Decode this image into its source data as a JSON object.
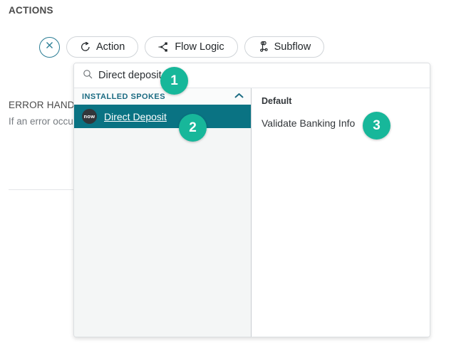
{
  "page": {
    "actions_heading": "ACTIONS"
  },
  "error_handling": {
    "title": "ERROR HANDLING",
    "description": "If an error occurs"
  },
  "add_step_row": {
    "close_button": {
      "icon": "close-x-icon",
      "label": ""
    },
    "buttons": [
      {
        "label": "Action",
        "icon": "action-arrow-icon"
      },
      {
        "label": "Flow Logic",
        "icon": "flow-logic-icon"
      },
      {
        "label": "Subflow",
        "icon": "subflow-icon"
      }
    ]
  },
  "spoke_panel": {
    "search": {
      "value": "Direct deposit",
      "placeholder": "Search",
      "icon": "search-icon"
    },
    "spokes_column": {
      "group_header": "INSTALLED SPOKES",
      "collapse_icon": "chevron-up-icon",
      "items": [
        {
          "label": "Direct Deposit",
          "avatar_text": "now",
          "selected": true
        }
      ]
    },
    "actions_column": {
      "group_header": "Default",
      "items": [
        {
          "label": "Validate Banking Info"
        }
      ]
    }
  },
  "annotations": [
    {
      "number": "1",
      "color": "#17b79a"
    },
    {
      "number": "2",
      "color": "#17b79a"
    },
    {
      "number": "3",
      "color": "#17b79a"
    }
  ]
}
